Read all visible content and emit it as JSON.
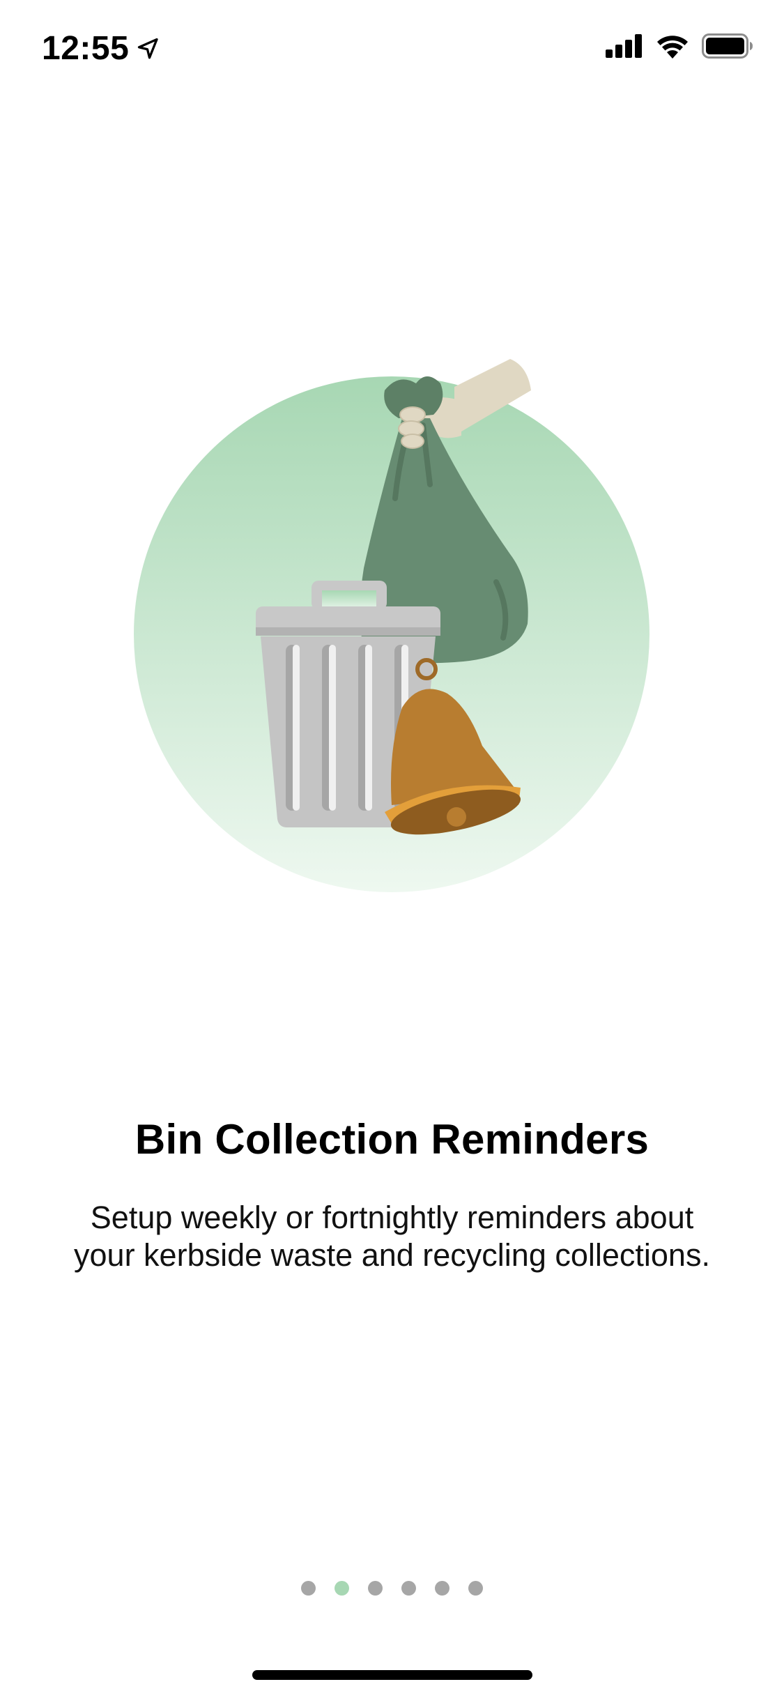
{
  "status_bar": {
    "time": "12:55",
    "location_icon": "location-arrow-icon",
    "signal_icon": "cellular-signal-icon",
    "wifi_icon": "wifi-icon",
    "battery_icon": "battery-icon"
  },
  "illustration": {
    "icon": "bin-bag-bell-illustration",
    "circle_color_top": "#a7d7b3",
    "circle_color_bottom": "#eef8f0",
    "bag_color": "#678c72",
    "bell_color": "#b87d30"
  },
  "onboarding": {
    "title": "Bin Collection Reminders",
    "description": "Setup weekly or fortnightly reminders about your kerbside waste and recycling collections."
  },
  "pagination": {
    "total_pages": 6,
    "current_page": 2,
    "active_color": "#a7d7b3",
    "inactive_color": "#a6a6a6"
  }
}
